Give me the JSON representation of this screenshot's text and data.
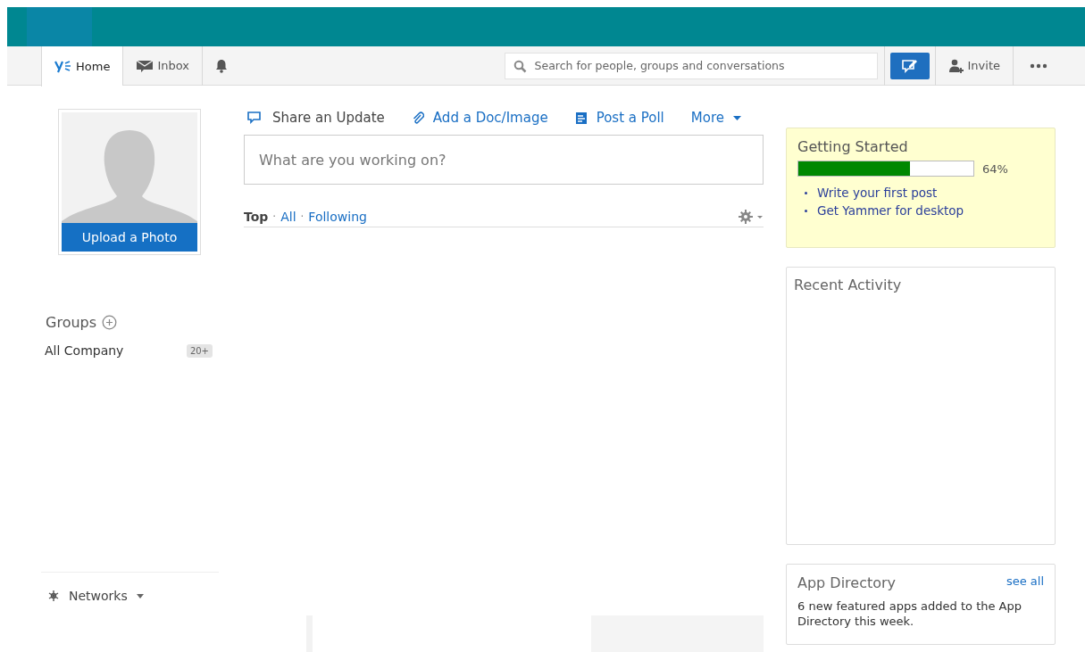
{
  "nav": {
    "tabs": [
      {
        "label": "Home",
        "selected": true
      },
      {
        "label": "Inbox",
        "selected": false
      },
      {
        "selected": false
      }
    ],
    "search": {
      "placeholder": "Search for people, groups and conversations"
    },
    "invite": "Invite"
  },
  "profile": {
    "upload": "Upload a Photo"
  },
  "groups": {
    "title": "Groups",
    "items": [
      {
        "name": "All Company",
        "count": "20+"
      }
    ]
  },
  "networks": "Networks",
  "publisher": {
    "actions": [
      {
        "label": "Share an Update",
        "selected": true
      },
      {
        "label": "Add a Doc/Image",
        "selected": false
      },
      {
        "label": "Post a Poll",
        "selected": false
      },
      {
        "label": "More",
        "selected": false
      }
    ],
    "placeholder": "What are you working on?"
  },
  "feed": {
    "separator": "·",
    "filters": [
      {
        "label": "Top",
        "selected": true
      },
      {
        "label": "All",
        "selected": false
      },
      {
        "label": "Following",
        "selected": false
      }
    ]
  },
  "getting_started": {
    "title": "Getting Started",
    "level": 0.64,
    "reading": "64%",
    "links": [
      "Write your first post",
      "Get Yammer for desktop"
    ]
  },
  "recent_activity": {
    "title": "Recent Activity"
  },
  "app_directory": {
    "title": "App Directory",
    "see_all": "see all",
    "text": "6 new featured apps added to the App Directory this week."
  }
}
